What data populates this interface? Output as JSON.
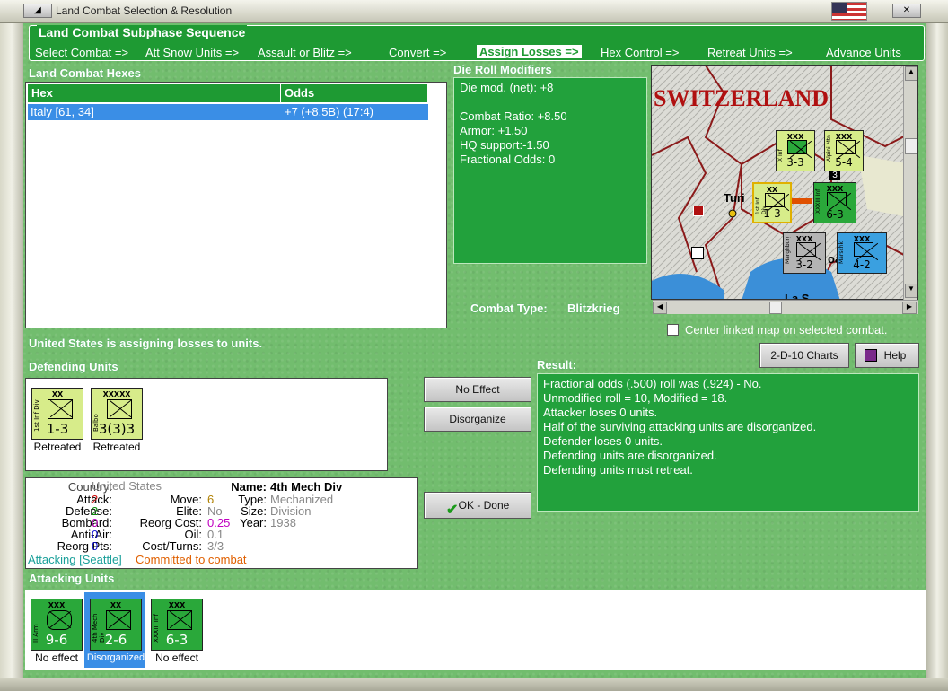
{
  "window": {
    "title": "Land Combat Selection & Resolution"
  },
  "subphase": {
    "title": "Land Combat Subphase Sequence",
    "steps": [
      "Select Combat =>",
      "Att Snow Units =>",
      "Assault or Blitz =>",
      "Convert =>",
      "Assign Losses =>",
      "Hex Control =>",
      "Retreat Units =>",
      "Advance Units"
    ],
    "active_index": 4
  },
  "hexes": {
    "title": "Land Combat Hexes",
    "col_hex": "Hex",
    "col_odds": "Odds",
    "rows": [
      {
        "hex": "Italy [61, 34]",
        "odds": "+7 (+8.5B) (17:4)"
      }
    ]
  },
  "modifiers": {
    "title": "Die Roll Modifiers",
    "net": "Die mod. (net): +8",
    "lines": [
      "Combat Ratio: +8.50",
      "Armor: +1.50",
      "HQ support:-1.50",
      "Fractional Odds: 0"
    ]
  },
  "combat_type": {
    "label": "Combat Type:",
    "value": "Blitzkrieg"
  },
  "map": {
    "region_label": "SWITZERLAND",
    "city1": "Turi",
    "city2": "oa",
    "city3": "La S",
    "counters": [
      {
        "size": "XXX",
        "name": "X Inf",
        "str": "3-3",
        "color": "#d7ec8a"
      },
      {
        "size": "XXX",
        "name": "Alpini Mtn",
        "str": "5-4",
        "color": "#d7ec8a"
      },
      {
        "size": "XX",
        "name": "1st Inf Div",
        "str": "1-3",
        "color": "#d7ec8a"
      },
      {
        "size": "XXX",
        "name": "XXXIII Inf",
        "str": "6-3",
        "color": "#2aa83a"
      },
      {
        "size": "XXX",
        "name": "Marghburg",
        "str": "3-2",
        "color": "#b4b4b4"
      },
      {
        "size": "XXX",
        "name": "Marschk",
        "str": "4-2",
        "color": "#3aa0e0"
      }
    ],
    "stack_badge": "3",
    "center_checkbox": "Center linked map on selected combat."
  },
  "charts_button": "2-D-10 Charts",
  "help_button": "Help",
  "status": "United States is assigning losses to units.",
  "defending": {
    "title": "Defending Units",
    "units": [
      {
        "size": "XX",
        "name": "1st Inf Div",
        "str": "1-3",
        "caption": "Retreated"
      },
      {
        "size": "XXXXX",
        "name": "Balbo",
        "str": "3(3)3",
        "caption": "Retreated"
      }
    ]
  },
  "buttons": {
    "no_effect": "No Effect",
    "disorganize": "Disorganize",
    "ok_done": "OK - Done"
  },
  "result": {
    "title": "Result:",
    "lines": [
      "Fractional odds (.500) roll was (.924)  - No.",
      "Unmodified roll = 10, Modified = 18.",
      "Attacker loses 0 units.",
      "Half of the surviving attacking units are disorganized.",
      "Defender loses 0 units.",
      "Defending units are disorganized.",
      "Defending units must retreat."
    ]
  },
  "unit_info": {
    "country_label": "Country:",
    "country": "United States",
    "name_label": "Name:",
    "name": "4th Mech Div",
    "attack_label": "Attack:",
    "attack": "2",
    "defense_label": "Defense:",
    "defense": "2",
    "bombard_label": "Bombard:",
    "bombard": "0",
    "antiair_label": "Anti-Air:",
    "antiair": "0",
    "reorg_label": "Reorg Pts:",
    "reorg": "0",
    "move_label": "Move:",
    "move": "6",
    "elite_label": "Elite:",
    "elite": "No",
    "reorgcost_label": "Reorg Cost:",
    "reorgcost": "0.25",
    "oil_label": "Oil:",
    "oil": "0.1",
    "costturns_label": "Cost/Turns:",
    "costturns": "3/3",
    "type_label": "Type:",
    "type": "Mechanized",
    "size_label": "Size:",
    "size": "Division",
    "year_label": "Year:",
    "year": "1938",
    "attacking": "Attacking [Seattle]",
    "committed": "Committed to combat"
  },
  "attacking": {
    "title": "Attacking Units",
    "units": [
      {
        "size": "XXX",
        "name": "II Arm",
        "str": "9-6",
        "caption": "No effect"
      },
      {
        "size": "XX",
        "name": "4th Mech Div",
        "str": "2-6",
        "caption": "Disorganized"
      },
      {
        "size": "XXX",
        "name": "XXXIII Inf",
        "str": "6-3",
        "caption": "No effect"
      }
    ]
  },
  "colors": {
    "felt": "#72bd6e",
    "panel": "#22a13c",
    "header": "#1e9a33",
    "select": "#3a8ee6",
    "attack": "#d01010",
    "defense": "#0a8a0a",
    "bombard": "#c000c0",
    "antiair": "#1010d0",
    "orange": "#e06000",
    "teal": "#1aa09a"
  }
}
